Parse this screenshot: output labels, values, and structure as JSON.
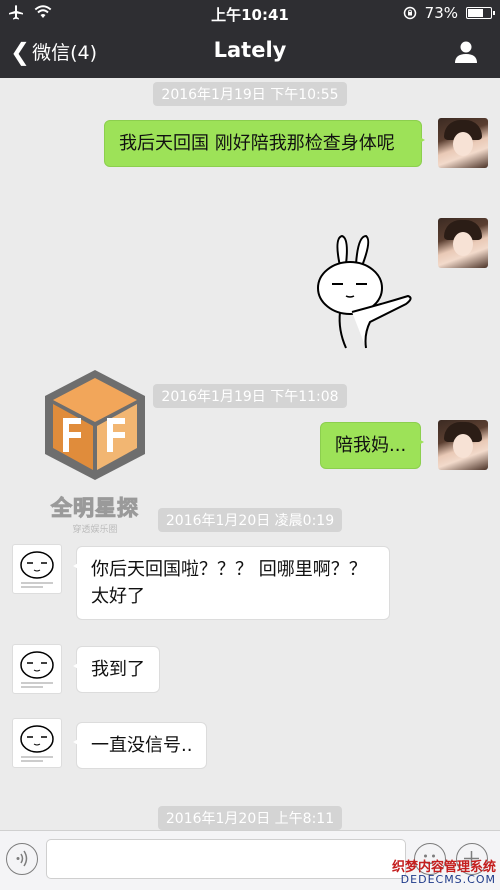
{
  "status_bar": {
    "time": "上午10:41",
    "battery": "73%",
    "icons": [
      "airplane-icon",
      "wifi-icon",
      "rotation-lock-icon",
      "battery-icon"
    ]
  },
  "nav": {
    "back_label": "微信(4)",
    "title": "Lately",
    "icons": [
      "chevron-left-icon",
      "person-icon"
    ]
  },
  "timestamps": [
    "2016年1月19日 下午10:55",
    "2016年1月19日 下午11:08",
    "2016年1月20日 凌晨0:19",
    "2016年1月20日 上午8:11"
  ],
  "messages": [
    {
      "side": "out",
      "text": "我后天回国 刚好陪我那检查身体呢"
    },
    {
      "side": "out",
      "type": "sticker"
    },
    {
      "side": "out",
      "text": "陪我妈..."
    },
    {
      "side": "in",
      "text": "你后天回国啦？？？ 回哪里啊？？太好了"
    },
    {
      "side": "in",
      "text": "我到了"
    },
    {
      "side": "in",
      "text": "一直没信号.."
    }
  ],
  "watermark": {
    "text": "全明星探",
    "sub": "穿透娱乐圈"
  },
  "input_bar": {
    "icons": [
      "voice-icon",
      "emoji-icon",
      "plus-icon"
    ]
  },
  "site_watermark": {
    "line1": "织梦内容管理系统",
    "line2": "DEDECMS.COM"
  },
  "colors": {
    "bar": "#2e2e32",
    "chat_bg": "#ebebeb",
    "outgoing": "#9de258",
    "incoming": "#ffffff"
  }
}
